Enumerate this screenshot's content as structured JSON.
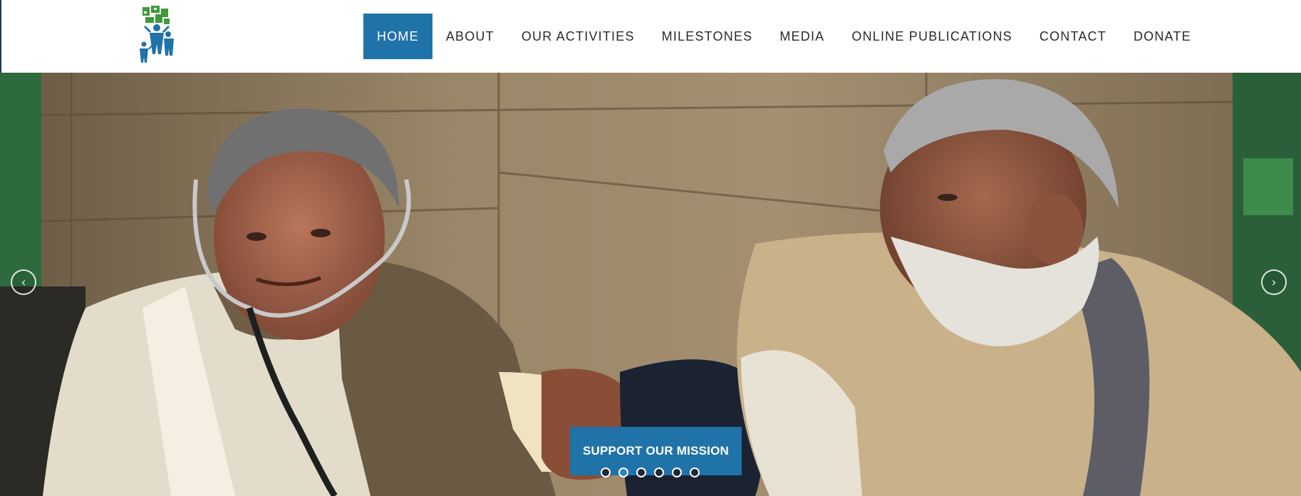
{
  "nav": {
    "items": [
      {
        "label": "HOME",
        "active": true
      },
      {
        "label": "ABOUT",
        "active": false
      },
      {
        "label": "OUR ACTIVITIES",
        "active": false
      },
      {
        "label": "MILESTONES",
        "active": false
      },
      {
        "label": "MEDIA",
        "active": false
      },
      {
        "label": "ONLINE PUBLICATIONS",
        "active": false
      },
      {
        "label": "CONTACT",
        "active": false
      },
      {
        "label": "DONATE",
        "active": false
      }
    ]
  },
  "slider": {
    "cta_label": "SUPPORT OUR MISSION",
    "prev_icon": "chevron-left-icon",
    "next_icon": "chevron-right-icon",
    "slide_count": 6,
    "active_index": 1,
    "image": "doctor-checking-elderly-patient-blood-pressure-photo"
  },
  "colors": {
    "accent": "#1f73a8",
    "nav_text": "#2b2b2b",
    "logo_green": "#3f9a3a",
    "logo_blue": "#1f73a8"
  }
}
